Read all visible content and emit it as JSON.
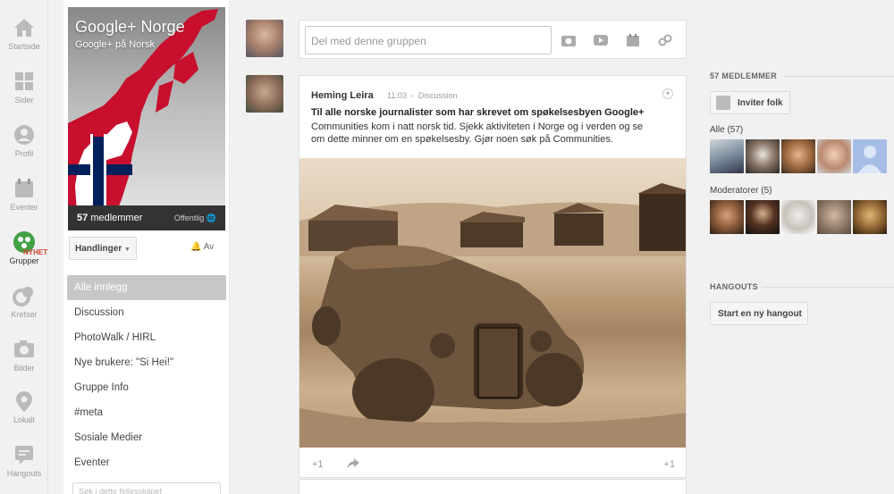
{
  "rail": {
    "items": [
      {
        "label": "Startside",
        "icon": "home-icon"
      },
      {
        "label": "Sider",
        "icon": "pages-icon"
      },
      {
        "label": "Profil",
        "icon": "profile-icon"
      },
      {
        "label": "Eventer",
        "icon": "events-icon"
      },
      {
        "label": "Grupper",
        "icon": "communities-icon"
      },
      {
        "label": "Kretser",
        "icon": "circles-icon"
      },
      {
        "label": "Bilder",
        "icon": "photos-icon"
      },
      {
        "label": "Lokalt",
        "icon": "local-icon"
      },
      {
        "label": "Hangouts",
        "icon": "hangouts-icon"
      }
    ],
    "new_badge": "NYHET"
  },
  "community": {
    "name": "Google+ Norge",
    "tagline": "Google+ på Norsk",
    "members_count": "57",
    "members_label": "medlemmer",
    "visibility": "Offentlig",
    "actions_label": "Handlinger",
    "notify_label": "Av",
    "categories": [
      "Alle innlegg",
      "Discussion",
      "PhotoWalk / HIRL",
      "Nye brukere: \"Si Hei!\"",
      "Gruppe Info",
      "#meta",
      "Sosiale Medier",
      "Eventer"
    ],
    "search_placeholder": "Søk i dette fellesskapet"
  },
  "share": {
    "placeholder": "Del med denne gruppen"
  },
  "post": {
    "author": "Heming Leira",
    "time": "11:03",
    "category": "Discussion",
    "title": "Til alle norske journalister som har skrevet om spøkelsesbyen Google+",
    "body_line1": "Communities kom i natt norsk tid. Sjekk aktiviteten i Norge og i verden og se",
    "body_line2": "om dette minner om en spøkelsesby. Gjør noen søk på Communities.",
    "plus_label": "+1",
    "plus_count": "+1"
  },
  "sidebar": {
    "members_heading": "57 MEDLEMMER",
    "invite_label": "Inviter folk",
    "all_label": "Alle (57)",
    "mods_label": "Moderatorer (5)",
    "hangouts_heading": "HANGOUTS",
    "hangout_button": "Start en ny hangout"
  },
  "colors": {
    "accent_red": "#d23f31",
    "communities_green": "#43a047"
  }
}
